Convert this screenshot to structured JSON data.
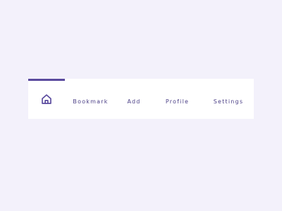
{
  "nav": {
    "active_tab": "home",
    "accent_color": "#5a4a9e",
    "text_color": "#4b3f86",
    "background_color": "#f3f1fb",
    "bar_color": "#ffffff",
    "tabs": [
      {
        "id": "home",
        "icon": "home-icon",
        "label": ""
      },
      {
        "id": "bookmark",
        "label": "Bookmark"
      },
      {
        "id": "add",
        "label": "Add"
      },
      {
        "id": "profile",
        "label": "Profile"
      },
      {
        "id": "settings",
        "label": "Settings"
      }
    ]
  }
}
